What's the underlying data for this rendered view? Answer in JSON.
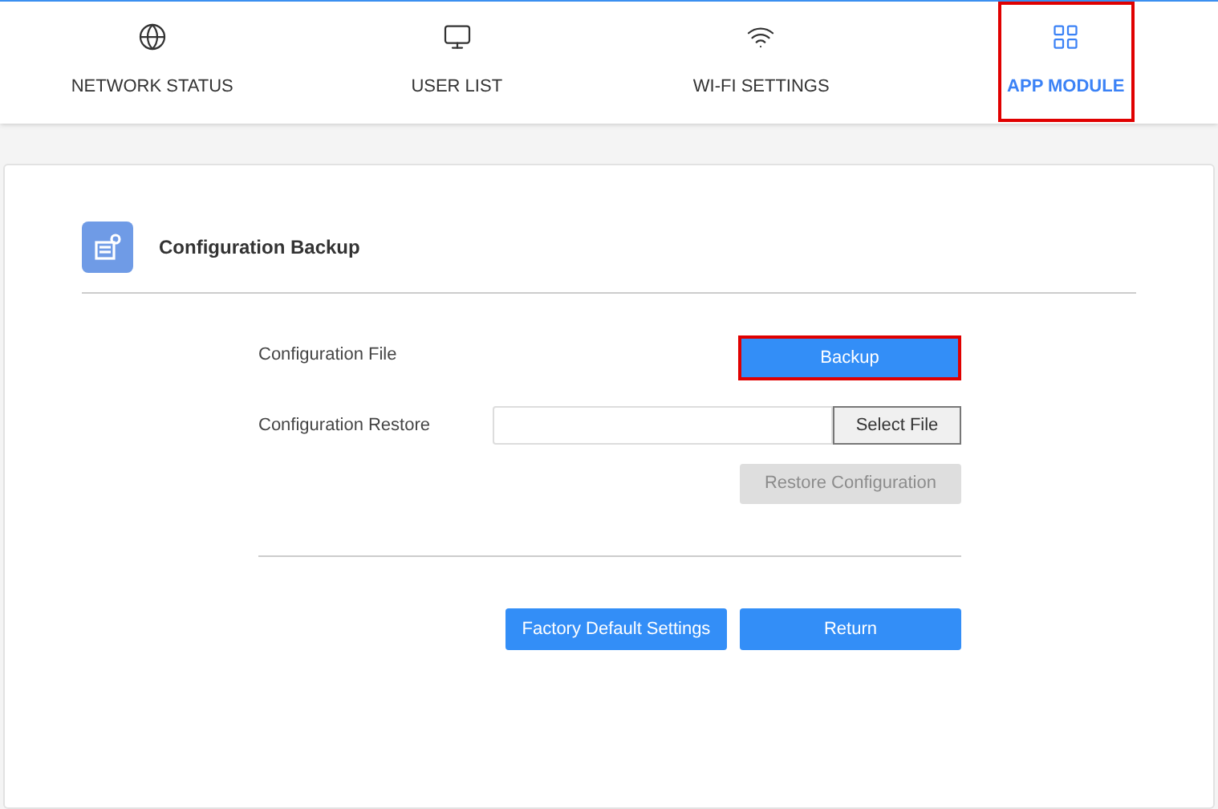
{
  "tabs": [
    {
      "label": "NETWORK STATUS",
      "kind": "globe",
      "selected": false,
      "highlighted": false
    },
    {
      "label": "USER LIST",
      "kind": "monitor",
      "selected": false,
      "highlighted": false
    },
    {
      "label": "WI-FI SETTINGS",
      "kind": "wifi",
      "selected": false,
      "highlighted": false
    },
    {
      "label": "APP MODULE",
      "kind": "apps",
      "selected": true,
      "highlighted": true
    }
  ],
  "section": {
    "title": "Configuration Backup"
  },
  "config_file": {
    "label": "Configuration File",
    "button": {
      "label": "Backup",
      "highlighted": true
    }
  },
  "config_restore": {
    "label": "Configuration Restore",
    "file_button": "Select File",
    "restore_button": {
      "label": "Restore Configuration",
      "disabled": true
    }
  },
  "footer_buttons": [
    "Factory Default Settings",
    "Return"
  ]
}
